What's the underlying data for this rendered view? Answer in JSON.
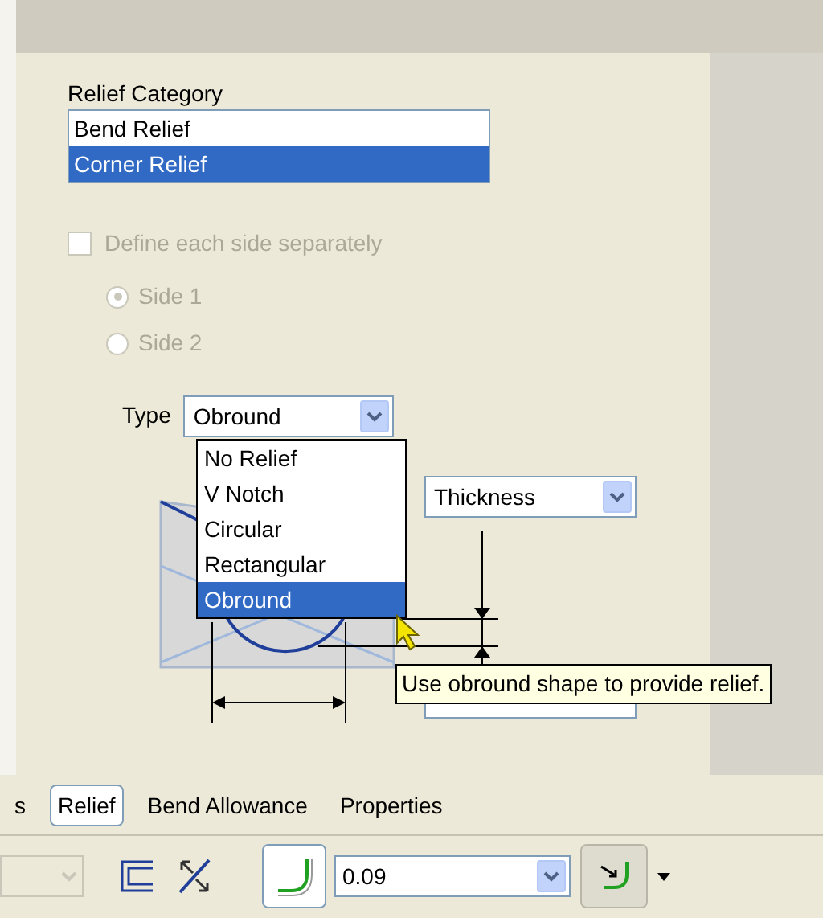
{
  "relief_category": {
    "label": "Relief Category",
    "items": [
      {
        "label": "Bend Relief",
        "selected": false
      },
      {
        "label": "Corner Relief",
        "selected": true
      }
    ]
  },
  "define_each_side": {
    "label": "Define each side separately",
    "checked": false,
    "disabled": true
  },
  "sides": [
    {
      "label": "Side 1",
      "selected": true,
      "disabled": true
    },
    {
      "label": "Side 2",
      "selected": false,
      "disabled": true
    }
  ],
  "type": {
    "label": "Type",
    "value": "Obround",
    "expanded": true,
    "options": [
      {
        "label": "No Relief",
        "selected": false
      },
      {
        "label": "V Notch",
        "selected": false
      },
      {
        "label": "Circular",
        "selected": false
      },
      {
        "label": "Rectangular",
        "selected": false
      },
      {
        "label": "Obround",
        "selected": true
      }
    ]
  },
  "dimension_field": {
    "value": "Thickness"
  },
  "tooltip": "Use obround shape to provide relief.",
  "tabs": [
    {
      "label": "s",
      "selected": false
    },
    {
      "label": "Relief",
      "selected": true
    },
    {
      "label": "Bend Allowance",
      "selected": false
    },
    {
      "label": "Properties",
      "selected": false
    }
  ],
  "toolbar": {
    "thickness_value": "0.09"
  }
}
